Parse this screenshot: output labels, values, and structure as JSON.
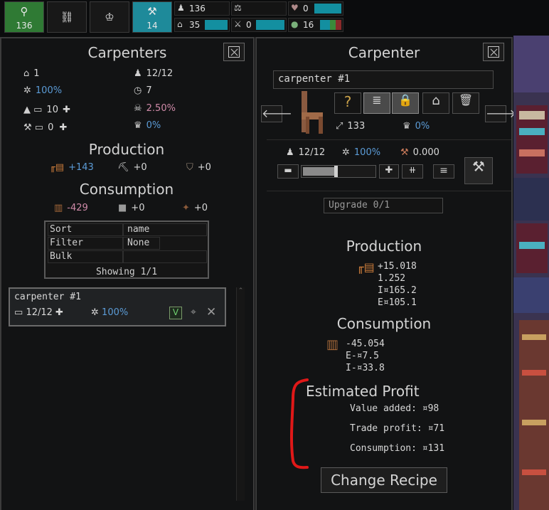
{
  "topbar": {
    "tiles": [
      {
        "icon": "person-icon",
        "glyph": "⚲",
        "value": "136",
        "color": "#2f7a34"
      },
      {
        "icon": "chain-icon",
        "glyph": "⛓",
        "value": "",
        "color": "#181818"
      },
      {
        "icon": "crown-icon",
        "glyph": "♔",
        "value": "",
        "color": "#181818"
      },
      {
        "icon": "hammer-icon",
        "glyph": "⚒",
        "value": "14",
        "color": "#1e8a9a"
      }
    ],
    "meters": [
      {
        "icon": "worker-icon",
        "value": "136"
      },
      {
        "icon": "scales-icon",
        "value": ""
      },
      {
        "icon": "heart-icon",
        "value": "0"
      },
      {
        "icon": "house-icon",
        "value": "35"
      },
      {
        "icon": "sword-icon",
        "value": "0"
      },
      {
        "icon": "food-icon",
        "value": "16"
      }
    ]
  },
  "left": {
    "title": "Carpenters",
    "stats": {
      "houses": "1",
      "workers": "12/12",
      "efficiency": "100%",
      "time": "7",
      "priority": "10",
      "death_rate": "2.50%",
      "tools": "0",
      "crown_rate": "0%"
    },
    "production_title": "Production",
    "production": [
      "+143",
      "+0",
      "+0"
    ],
    "consumption_title": "Consumption",
    "consumption": [
      "-429",
      "+0",
      "+0"
    ],
    "table": {
      "sort_label": "Sort",
      "sort_value": "name",
      "filter_label": "Filter",
      "filter_value": "None",
      "bulk_label": "Bulk",
      "showing": "Showing 1/1"
    },
    "card": {
      "name": "carpenter #1",
      "workers": "12/12",
      "efficiency": "100%",
      "check": "V"
    }
  },
  "right": {
    "title": "Carpenter",
    "name": "carpenter #1",
    "question": "?",
    "radius": "133",
    "crown_rate": "0%",
    "workers": "12/12",
    "efficiency": "100%",
    "tools": "0.000",
    "upgrade": "Upgrade  0/1",
    "production_title": "Production",
    "production_lines": [
      "+15.018",
      "1.252",
      "I¤165.2",
      "E¤105.1"
    ],
    "consumption_title": "Consumption",
    "consumption_lines": [
      "-45.054",
      "E-¤7.5",
      "I-¤33.8"
    ],
    "profit_title": "Estimated Profit",
    "value_added": "Value added: ¤98",
    "trade_profit": "Trade profit: ¤71",
    "consumption_cost": "Consumption: ¤131",
    "change_recipe": "Change Recipe"
  }
}
